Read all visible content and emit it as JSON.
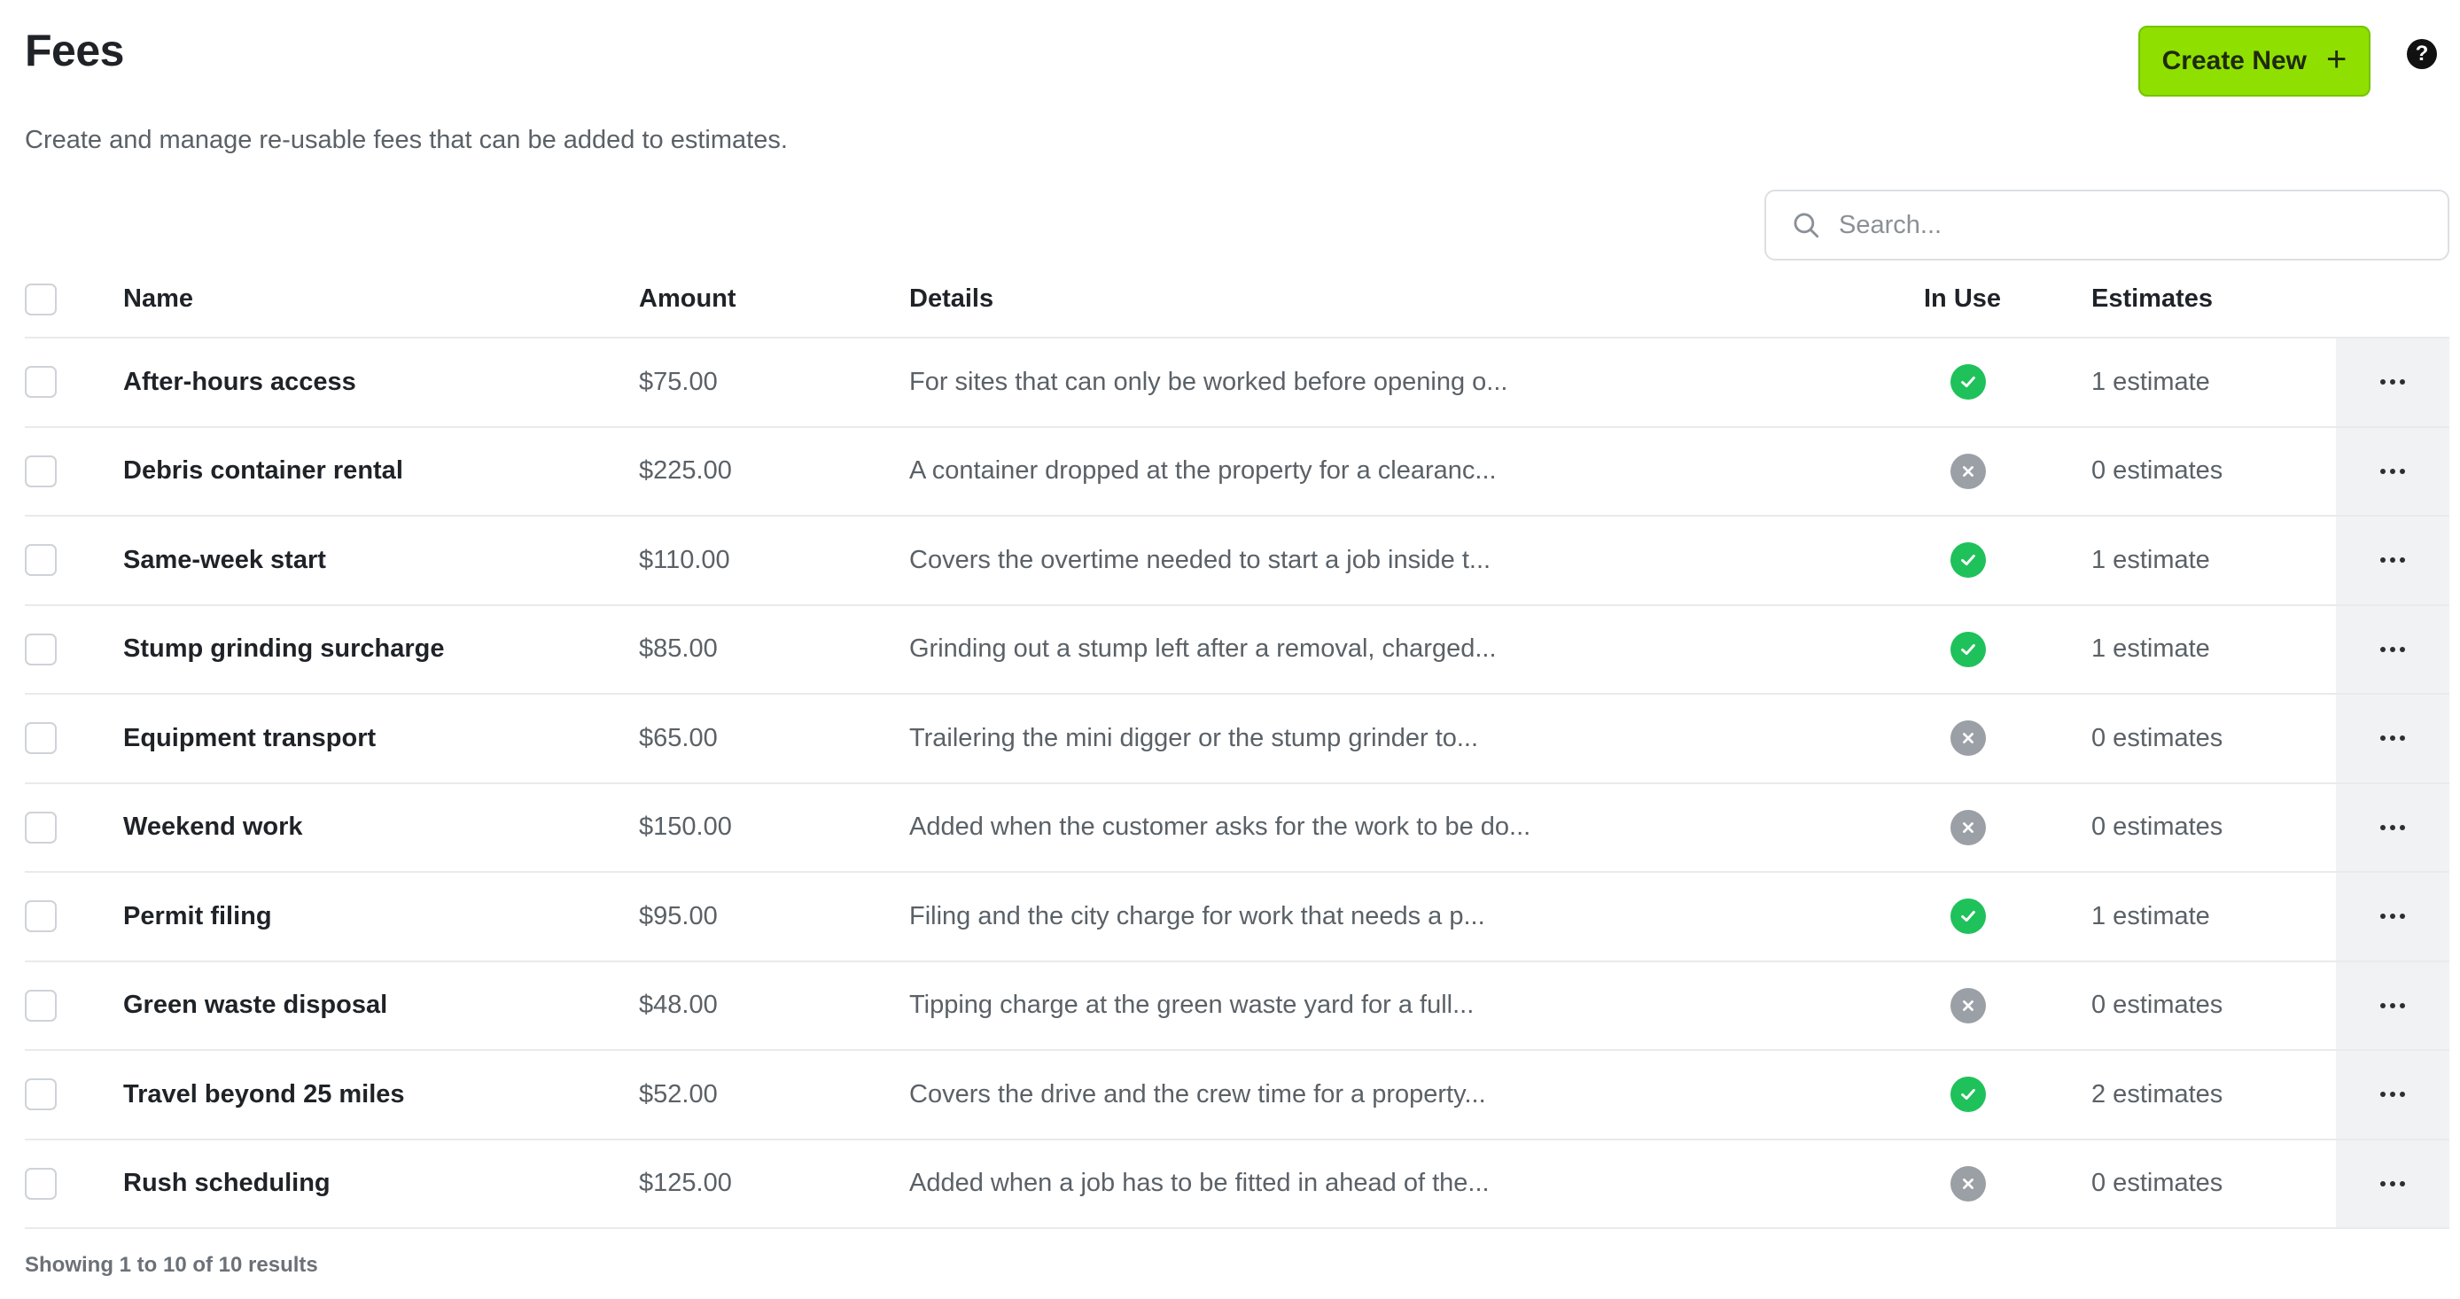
{
  "header": {
    "title": "Fees",
    "subtitle": "Create and manage re-usable fees that can be added to estimates.",
    "create_label": "Create New",
    "help_icon": "?"
  },
  "search": {
    "placeholder": "Search..."
  },
  "table": {
    "columns": {
      "name": "Name",
      "amount": "Amount",
      "details": "Details",
      "in_use": "In Use",
      "estimates": "Estimates"
    },
    "rows": [
      {
        "name": "After-hours access",
        "amount": "$75.00",
        "details": "For sites that can only be worked before opening o...",
        "in_use": true,
        "estimates": "1 estimate"
      },
      {
        "name": "Debris container rental",
        "amount": "$225.00",
        "details": "A container dropped at the property for a clearanc...",
        "in_use": false,
        "estimates": "0 estimates"
      },
      {
        "name": "Same-week start",
        "amount": "$110.00",
        "details": "Covers the overtime needed to start a job inside t...",
        "in_use": true,
        "estimates": "1 estimate"
      },
      {
        "name": "Stump grinding surcharge",
        "amount": "$85.00",
        "details": "Grinding out a stump left after a removal, charged...",
        "in_use": true,
        "estimates": "1 estimate"
      },
      {
        "name": "Equipment transport",
        "amount": "$65.00",
        "details": "Trailering the mini digger or the stump grinder to...",
        "in_use": false,
        "estimates": "0 estimates"
      },
      {
        "name": "Weekend work",
        "amount": "$150.00",
        "details": "Added when the customer asks for the work to be do...",
        "in_use": false,
        "estimates": "0 estimates"
      },
      {
        "name": "Permit filing",
        "amount": "$95.00",
        "details": "Filing and the city charge for work that needs a p...",
        "in_use": true,
        "estimates": "1 estimate"
      },
      {
        "name": "Green waste disposal",
        "amount": "$48.00",
        "details": "Tipping charge at the green waste yard for a full...",
        "in_use": false,
        "estimates": "0 estimates"
      },
      {
        "name": "Travel beyond 25 miles",
        "amount": "$52.00",
        "details": "Covers the drive and the crew time for a property...",
        "in_use": true,
        "estimates": "2 estimates"
      },
      {
        "name": "Rush scheduling",
        "amount": "$125.00",
        "details": "Added when a job has to be fitted in ahead of the...",
        "in_use": false,
        "estimates": "0 estimates"
      }
    ]
  },
  "footer": {
    "summary": "Showing 1 to 10 of 10 results"
  },
  "colors": {
    "accent": "#8fe000",
    "in_use_yes": "#1fc15a",
    "in_use_no": "#9aa0a6"
  },
  "icons": {
    "search": "search-icon",
    "check": "check-icon",
    "x": "x-icon",
    "more": "more-horizontal-icon",
    "help": "help-icon",
    "plus": "plus-icon"
  }
}
